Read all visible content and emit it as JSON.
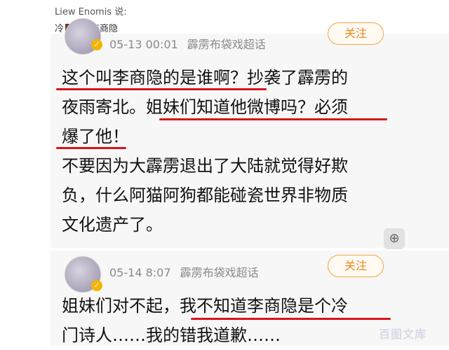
{
  "quote": {
    "author": "Liew Enomis 说:",
    "line_prefix": "冷",
    "line_rest": "诗人李商隐"
  },
  "posts": [
    {
      "time": "05-13 00:01",
      "source": "霹雳布袋戏超话",
      "follow_label": "关注",
      "lines": [
        "这个叫李商隐的是谁啊？抄袭了霹雳的",
        "夜雨寄北。姐妹们知道他微博吗？必须",
        "爆了他！",
        "不要因为大霹雳退出了大陆就觉得好欺",
        "负，什么阿猫阿狗都能碰瓷世界非物质",
        "文化遗产了。"
      ]
    },
    {
      "time": "05-14 8:07",
      "source": "霹雳布袋戏超话",
      "follow_label": "关注",
      "lines": [
        "姐妹们对不起，我不知道李商隐是个冷",
        "门诗人……我的错我道歉……"
      ]
    }
  ],
  "zoom_icon": "zoom-in-icon",
  "watermark": "百图文库",
  "colors": {
    "underline": "#d9141c",
    "follow": "#e8891f",
    "verified": "#f5b400"
  }
}
